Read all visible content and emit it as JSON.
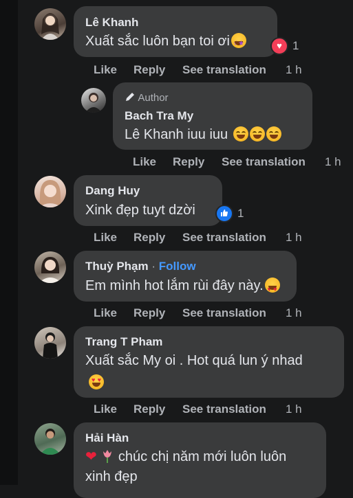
{
  "comments": [
    {
      "name": "Lê Khanh",
      "text": "Xuất sắc luôn bạn toi ơi",
      "reaction_count": "1",
      "actions": {
        "like": "Like",
        "reply": "Reply",
        "translate": "See translation",
        "time": "1 h"
      }
    },
    {
      "badge": "Author",
      "name": "Bach Tra My",
      "text": "Lê Khanh iuu iuu",
      "actions": {
        "like": "Like",
        "reply": "Reply",
        "translate": "See translation",
        "time": "1 h"
      }
    },
    {
      "name": "Dang Huy",
      "text": "Xink đẹp tuyt dzời",
      "reaction_count": "1",
      "actions": {
        "like": "Like",
        "reply": "Reply",
        "translate": "See translation",
        "time": "1 h"
      }
    },
    {
      "name": "Thuỳ Phạm",
      "follow_sep": " · ",
      "follow": "Follow",
      "text": "Em mình hot lắm rùi đây này.",
      "actions": {
        "like": "Like",
        "reply": "Reply",
        "translate": "See translation",
        "time": "1 h"
      }
    },
    {
      "name": "Trang T Pham",
      "text": "Xuất sắc My oi . Hot quá lun ý nhad",
      "actions": {
        "like": "Like",
        "reply": "Reply",
        "translate": "See translation",
        "time": "1 h"
      }
    },
    {
      "name": "Hải Hàn",
      "text_line1": "chúc chị năm mới luôn luôn",
      "text_line2": "xinh đẹp"
    }
  ],
  "icons": {
    "like_reaction": "thumbs-up-icon",
    "love_reaction": "heart-icon",
    "author_badge": "pencil-icon",
    "emoji_grin": "grinning-face-icon",
    "emoji_hearteyes": "heart-eyes-icon",
    "emoji_stareyes": "star-struck-icon"
  },
  "colors": {
    "background": "#18191a",
    "bubble": "#3a3b3c",
    "action_text": "#b0b3b8",
    "link": "#4599ff",
    "like_blue": "#1877f2",
    "love_red": "#f33e58"
  }
}
